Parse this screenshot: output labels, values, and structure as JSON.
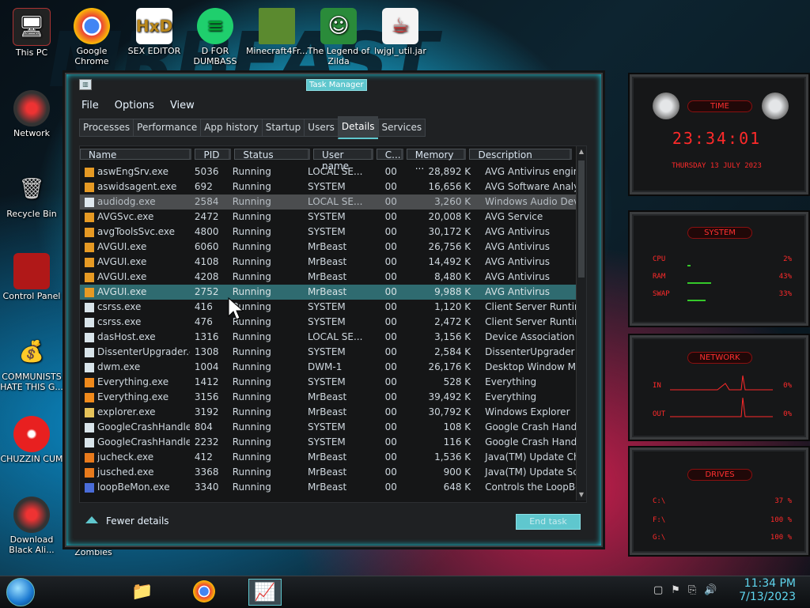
{
  "desktop_icons": [
    {
      "label": "This PC",
      "icon": "computer-icon"
    },
    {
      "label": "Google Chrome",
      "icon": "chrome-icon"
    },
    {
      "label": "SEX EDITOR",
      "icon": "hex-editor-icon"
    },
    {
      "label": "D FOR DUMBASS",
      "icon": "discord-like-icon"
    },
    {
      "label": "Minecraft4Fr...",
      "icon": "minecraft-icon"
    },
    {
      "label": "The Legend of Zilda",
      "icon": "game-character-icon"
    },
    {
      "label": "lwjgl_util.jar",
      "icon": "java-icon"
    },
    {
      "label": "Network",
      "icon": "network-icon"
    },
    {
      "label": "Recycle Bin",
      "icon": "recycle-bin-icon"
    },
    {
      "label": "Control Panel",
      "icon": "control-panel-icon"
    },
    {
      "label": "COMMUNISTS HATE THIS G...",
      "icon": "money-bag-icon"
    },
    {
      "label": "CHUZZIN CUM",
      "icon": "chuzzle-icon"
    },
    {
      "label": "Download Black Ali...",
      "icon": "alien-icon"
    },
    {
      "label": "Zombies",
      "icon": "zombies-icon"
    }
  ],
  "window": {
    "title": "Task Manager",
    "menu": [
      "File",
      "Options",
      "View"
    ],
    "tabs": [
      "Processes",
      "Performance",
      "App history",
      "Startup",
      "Users",
      "Details",
      "Services"
    ],
    "active_tab": "Details",
    "columns": [
      "Name",
      "PID",
      "Status",
      "User name",
      "C...",
      "Memory ...",
      "Description"
    ],
    "rows": [
      {
        "name": "aswEngSrv.exe",
        "pid": "5036",
        "status": "Running",
        "user": "LOCAL SE...",
        "cpu": "00",
        "mem": "28,892 K",
        "desc": "AVG Antivirus engin..."
      },
      {
        "name": "aswidsagent.exe",
        "pid": "692",
        "status": "Running",
        "user": "SYSTEM",
        "cpu": "00",
        "mem": "16,656 K",
        "desc": "AVG Software Analyz..."
      },
      {
        "name": "audiodg.exe",
        "pid": "2584",
        "status": "Running",
        "user": "LOCAL SE...",
        "cpu": "00",
        "mem": "3,260 K",
        "desc": "Windows Audio Devi..."
      },
      {
        "name": "AVGSvc.exe",
        "pid": "2472",
        "status": "Running",
        "user": "SYSTEM",
        "cpu": "00",
        "mem": "20,008 K",
        "desc": "AVG Service"
      },
      {
        "name": "avgToolsSvc.exe",
        "pid": "4800",
        "status": "Running",
        "user": "SYSTEM",
        "cpu": "00",
        "mem": "30,172 K",
        "desc": "AVG Antivirus"
      },
      {
        "name": "AVGUI.exe",
        "pid": "6060",
        "status": "Running",
        "user": "MrBeast",
        "cpu": "00",
        "mem": "26,756 K",
        "desc": "AVG Antivirus"
      },
      {
        "name": "AVGUI.exe",
        "pid": "4108",
        "status": "Running",
        "user": "MrBeast",
        "cpu": "00",
        "mem": "14,492 K",
        "desc": "AVG Antivirus"
      },
      {
        "name": "AVGUI.exe",
        "pid": "4208",
        "status": "Running",
        "user": "MrBeast",
        "cpu": "00",
        "mem": "8,480 K",
        "desc": "AVG Antivirus"
      },
      {
        "name": "AVGUI.exe",
        "pid": "2752",
        "status": "Running",
        "user": "MrBeast",
        "cpu": "00",
        "mem": "9,988 K",
        "desc": "AVG Antivirus"
      },
      {
        "name": "csrss.exe",
        "pid": "416",
        "status": "Running",
        "user": "SYSTEM",
        "cpu": "00",
        "mem": "1,120 K",
        "desc": "Client Server Runtim..."
      },
      {
        "name": "csrss.exe",
        "pid": "476",
        "status": "Running",
        "user": "SYSTEM",
        "cpu": "00",
        "mem": "2,472 K",
        "desc": "Client Server Runtim..."
      },
      {
        "name": "dasHost.exe",
        "pid": "1316",
        "status": "Running",
        "user": "LOCAL SE...",
        "cpu": "00",
        "mem": "3,156 K",
        "desc": "Device Association F..."
      },
      {
        "name": "DissenterUpgrader.exe",
        "pid": "1308",
        "status": "Running",
        "user": "SYSTEM",
        "cpu": "00",
        "mem": "2,584 K",
        "desc": "DissenterUpgrader"
      },
      {
        "name": "dwm.exe",
        "pid": "1004",
        "status": "Running",
        "user": "DWM-1",
        "cpu": "00",
        "mem": "26,176 K",
        "desc": "Desktop Window Ma..."
      },
      {
        "name": "Everything.exe",
        "pid": "1412",
        "status": "Running",
        "user": "SYSTEM",
        "cpu": "00",
        "mem": "528 K",
        "desc": "Everything"
      },
      {
        "name": "Everything.exe",
        "pid": "3156",
        "status": "Running",
        "user": "MrBeast",
        "cpu": "00",
        "mem": "39,492 K",
        "desc": "Everything"
      },
      {
        "name": "explorer.exe",
        "pid": "3192",
        "status": "Running",
        "user": "MrBeast",
        "cpu": "00",
        "mem": "30,792 K",
        "desc": "Windows Explorer"
      },
      {
        "name": "GoogleCrashHandler...",
        "pid": "804",
        "status": "Running",
        "user": "SYSTEM",
        "cpu": "00",
        "mem": "108 K",
        "desc": "Google Crash Handler"
      },
      {
        "name": "GoogleCrashHandler...",
        "pid": "2232",
        "status": "Running",
        "user": "SYSTEM",
        "cpu": "00",
        "mem": "116 K",
        "desc": "Google Crash Handler"
      },
      {
        "name": "jucheck.exe",
        "pid": "412",
        "status": "Running",
        "user": "MrBeast",
        "cpu": "00",
        "mem": "1,536 K",
        "desc": "Java(TM) Update Ch..."
      },
      {
        "name": "jusched.exe",
        "pid": "3368",
        "status": "Running",
        "user": "MrBeast",
        "cpu": "00",
        "mem": "900 K",
        "desc": "Java(TM) Update Sc..."
      },
      {
        "name": "loopBeMon.exe",
        "pid": "3340",
        "status": "Running",
        "user": "MrBeast",
        "cpu": "00",
        "mem": "648 K",
        "desc": "Controls the LoopBe..."
      }
    ],
    "fewer_details": "Fewer details",
    "end_task": "End task"
  },
  "gadgets": {
    "time": {
      "title": "TIME",
      "clock": "23:34:01",
      "date": "THURSDAY 13 JULY 2023"
    },
    "system": {
      "title": "SYSTEM",
      "cpu_label": "CPU",
      "cpu_val": "2%",
      "ram_label": "RAM",
      "ram_val": "43%",
      "swap_label": "SWAP",
      "swap_val": "33%",
      "cpu_level": 0.02,
      "ram_level": 0.43,
      "swap_level": 0.33
    },
    "network": {
      "title": "NETWORK",
      "in_label": "IN",
      "in_val": "0%",
      "out_label": "OUT",
      "out_val": "0%"
    },
    "drives": {
      "title": "DRIVES",
      "d1_label": "C:\\",
      "d1_val": "37 %",
      "d2_label": "F:\\",
      "d2_val": "100 %",
      "d3_label": "G:\\",
      "d3_val": "100 %"
    }
  },
  "taskbar": {
    "time": "11:34 PM",
    "date": "7/13/2023",
    "pinned": [
      "file-explorer-icon",
      "chrome-icon",
      "task-manager-icon"
    ]
  },
  "colors": {
    "accent": "#5fc7ce",
    "gadget_red": "#ff2a2a",
    "selection_teal": "#2f6b70"
  }
}
